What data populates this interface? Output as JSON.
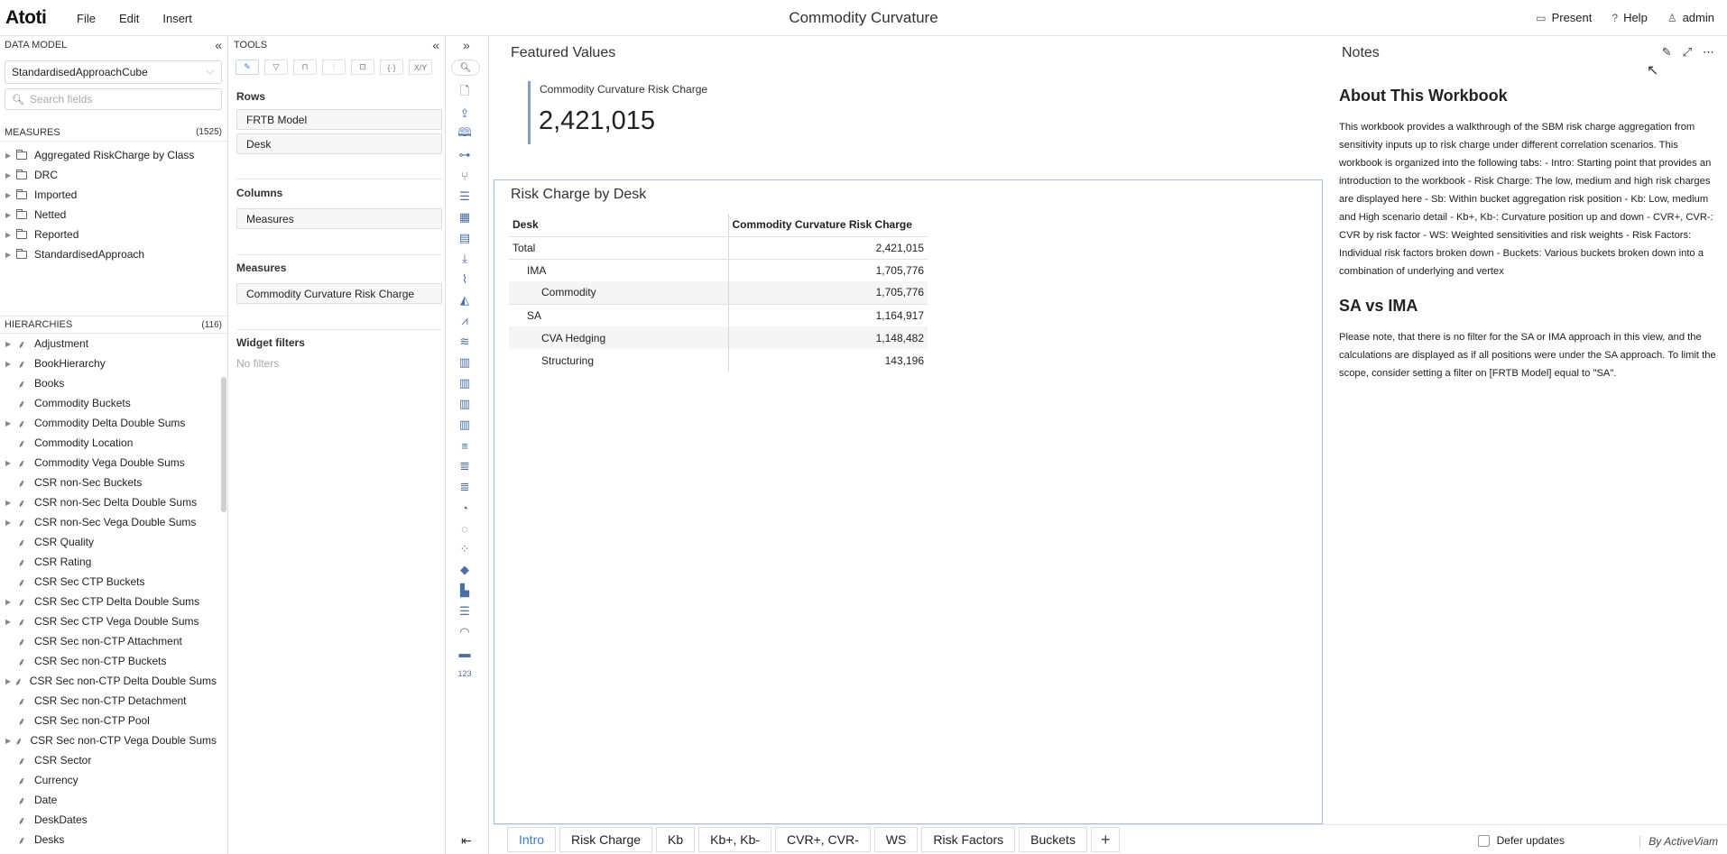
{
  "app": {
    "logo": "Atoti",
    "menu": [
      "File",
      "Edit",
      "Insert"
    ],
    "title": "Commodity Curvature",
    "present_label": "Present",
    "help_label": "Help",
    "user_label": "admin"
  },
  "data_model": {
    "header": "DATA MODEL",
    "cube": "StandardisedApproachCube",
    "search_placeholder": "Search fields",
    "measures_label": "MEASURES",
    "measures_count": "(1525)",
    "measures": [
      "Aggregated RiskCharge by Class",
      "DRC",
      "Imported",
      "Netted",
      "Reported",
      "StandardisedApproach"
    ],
    "hierarchies_label": "HIERARCHIES",
    "hierarchies_count": "(116)",
    "hierarchies": [
      {
        "label": "Adjustment",
        "expandable": true
      },
      {
        "label": "BookHierarchy",
        "expandable": true
      },
      {
        "label": "Books",
        "expandable": false
      },
      {
        "label": "Commodity Buckets",
        "expandable": false
      },
      {
        "label": "Commodity Delta Double Sums",
        "expandable": true
      },
      {
        "label": "Commodity Location",
        "expandable": false
      },
      {
        "label": "Commodity Vega Double Sums",
        "expandable": true
      },
      {
        "label": "CSR non-Sec Buckets",
        "expandable": false
      },
      {
        "label": "CSR non-Sec Delta Double Sums",
        "expandable": true
      },
      {
        "label": "CSR non-Sec Vega Double Sums",
        "expandable": true
      },
      {
        "label": "CSR Quality",
        "expandable": false
      },
      {
        "label": "CSR Rating",
        "expandable": false
      },
      {
        "label": "CSR Sec CTP Buckets",
        "expandable": false
      },
      {
        "label": "CSR Sec CTP Delta Double Sums",
        "expandable": true
      },
      {
        "label": "CSR Sec CTP Vega Double Sums",
        "expandable": true
      },
      {
        "label": "CSR Sec non-CTP Attachment",
        "expandable": false
      },
      {
        "label": "CSR Sec non-CTP Buckets",
        "expandable": false
      },
      {
        "label": "CSR Sec non-CTP Delta Double Sums",
        "expandable": true
      },
      {
        "label": "CSR Sec non-CTP Detachment",
        "expandable": false
      },
      {
        "label": "CSR Sec non-CTP Pool",
        "expandable": false
      },
      {
        "label": "CSR Sec non-CTP Vega Double Sums",
        "expandable": true
      },
      {
        "label": "CSR Sector",
        "expandable": false
      },
      {
        "label": "Currency",
        "expandable": false
      },
      {
        "label": "Date",
        "expandable": false
      },
      {
        "label": "DeskDates",
        "expandable": false
      },
      {
        "label": "Desks",
        "expandable": false
      }
    ]
  },
  "tools": {
    "header": "TOOLS",
    "tool_tabs": [
      "pencil",
      "filter",
      "paint",
      "sliders",
      "formula",
      "braces",
      "X/Y"
    ],
    "rows_label": "Rows",
    "rows": [
      "FRTB Model",
      "Desk"
    ],
    "columns_label": "Columns",
    "columns": [
      "Measures"
    ],
    "measures_label": "Measures",
    "measures": [
      "Commodity Curvature Risk Charge"
    ],
    "filters_label": "Widget filters",
    "no_filters": "No filters"
  },
  "featured": {
    "title": "Featured Values",
    "kpi_label": "Commodity Curvature Risk Charge",
    "kpi_value": "2,421,015"
  },
  "risk_by_desk": {
    "title": "Risk Charge by Desk",
    "col1": "Desk",
    "col2": "Commodity Curvature Risk Charge",
    "rows": [
      {
        "label": "Total",
        "value": "2,421,015",
        "level": 0,
        "grp": false,
        "alt": false
      },
      {
        "label": "IMA",
        "value": "1,705,776",
        "level": 1,
        "grp": true,
        "alt": false
      },
      {
        "label": "Commodity",
        "value": "1,705,776",
        "level": 2,
        "grp": false,
        "alt": true
      },
      {
        "label": "SA",
        "value": "1,164,917",
        "level": 1,
        "grp": true,
        "alt": false
      },
      {
        "label": "CVA Hedging",
        "value": "1,148,482",
        "level": 2,
        "grp": false,
        "alt": true
      },
      {
        "label": "Structuring",
        "value": "143,196",
        "level": 2,
        "grp": false,
        "alt": false
      }
    ]
  },
  "notes": {
    "title": "Notes",
    "h1": "About This Workbook",
    "p1": "This workbook provides a walkthrough of the SBM risk charge aggregation from sensitivity inputs up to risk charge under different correlation scenarios. This workbook is organized into the following tabs: - Intro: Starting point that provides an introduction to the workbook - Risk Charge: The low, medium and high risk charges are displayed here - Sb: Within bucket aggregation risk position - Kb: Low, medium and High scenario detail - Kb+, Kb-: Curvature position up and down - CVR+, CVR-: CVR by risk factor - WS: Weighted sensitivities and risk weights - Risk Factors: Individual risk factors broken down - Buckets: Various buckets broken down into a combination of underlying and vertex",
    "h2": "SA vs IMA",
    "p2": "Please note, that there is no filter for the SA or IMA approach in this view, and the calculations are displayed as if all positions were under the SA approach. To limit the scope, consider setting a filter on [FRTB Model] equal to \"SA\"."
  },
  "bottom": {
    "tabs": [
      "Intro",
      "Risk Charge",
      "Kb",
      "Kb+, Kb-",
      "CVR+, CVR-",
      "WS",
      "Risk Factors",
      "Buckets"
    ],
    "active_tab": "Intro",
    "add_tab": "+",
    "defer_label": "Defer updates",
    "brand": "By ActiveViam"
  }
}
